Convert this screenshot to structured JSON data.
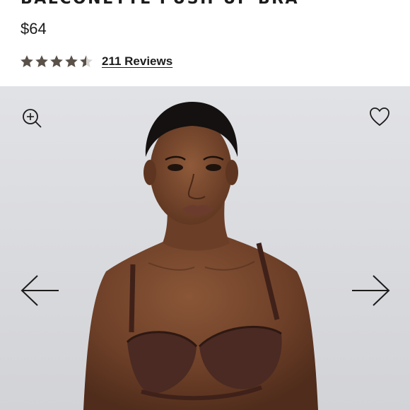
{
  "product": {
    "title": "BALCONETTE PUSH-UP BRA",
    "price": "$64",
    "rating": 4.5,
    "rating_max": 5,
    "reviews_label": "211 Reviews"
  },
  "colors": {
    "star_filled": "#5a5149",
    "star_empty": "#d6d3d0",
    "gallery_bg": "#dcdde1",
    "bra_color": "#4a2a22"
  },
  "icons": {
    "zoom": "zoom-in-icon",
    "wishlist": "heart-icon",
    "prev": "arrow-left-icon",
    "next": "arrow-right-icon"
  }
}
